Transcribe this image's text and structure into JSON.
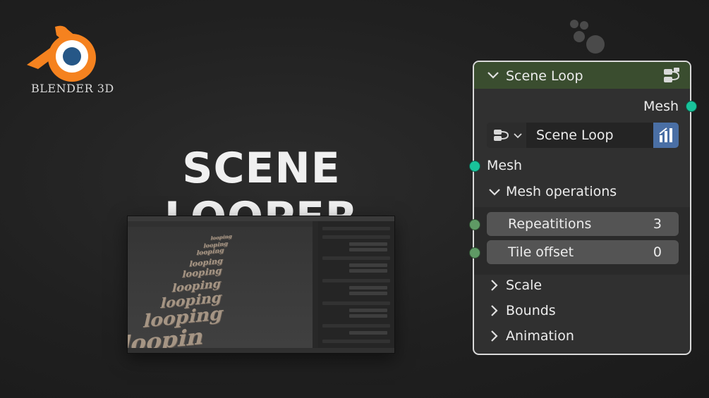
{
  "logo": {
    "text": "BLENDER 3D",
    "icon": "blender-logo-icon",
    "colors": {
      "orange": "#f5821f",
      "blue": "#265787"
    }
  },
  "title": "SCENE LOOPER",
  "preview": {
    "words": [
      "looping",
      "looping",
      "looping",
      "looping",
      "looping",
      "looping",
      "looping",
      "looping",
      "loopin"
    ]
  },
  "node": {
    "header_color": "#3a4d2f",
    "title": "Scene Loop",
    "output_label": "Mesh",
    "selector": {
      "value": "Scene Loop",
      "button_color": "#4a6fa5"
    },
    "input_label": "Mesh",
    "panels": {
      "mesh_operations": "Mesh operations",
      "scale": "Scale",
      "bounds": "Bounds",
      "animation": "Animation"
    },
    "fields": [
      {
        "label": "Repeatitions",
        "value": "3"
      },
      {
        "label": "Tile offset",
        "value": "0"
      }
    ],
    "socket_color": "#19c39b"
  }
}
